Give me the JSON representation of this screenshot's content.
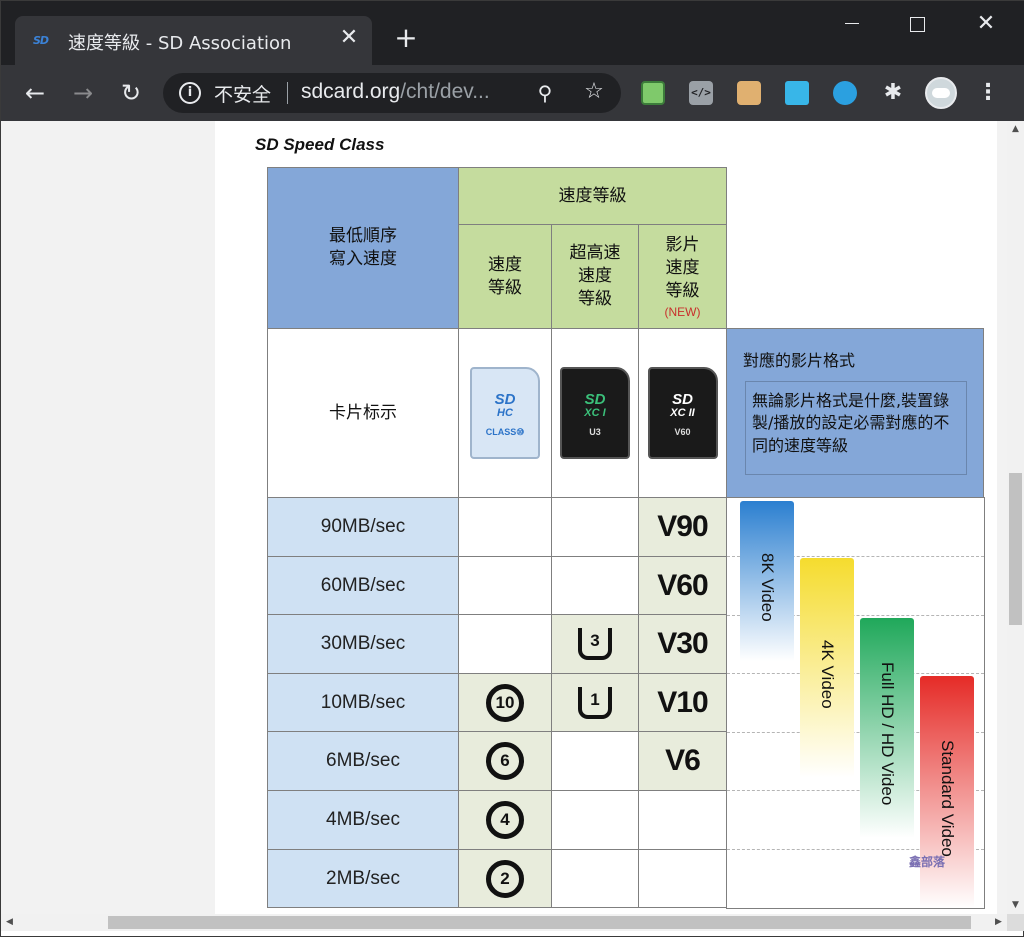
{
  "browser": {
    "tab_title": "速度等級 - SD Association",
    "tab_favicon": "SD",
    "security_label": "不安全",
    "url_host": "sdcard.org",
    "url_path": "/cht/dev...",
    "icons": {
      "back": "arrow-left-icon",
      "forward": "arrow-right-icon",
      "reload": "reload-icon",
      "info": "info-icon",
      "zoom": "zoom-icon",
      "bookmark": "star-icon",
      "extensions": "puzzle-icon",
      "menu": "kebab-menu-icon"
    }
  },
  "page": {
    "heading": "SD Speed Class",
    "table": {
      "col_min_write": "最低順序\n寫入速度",
      "col_speed_group": "速度等級",
      "col_speed_class": "速度\n等級",
      "col_uhs_class": "超高速\n速度\n等級",
      "col_video_class": "影片\n速度\n等級",
      "new_tag": "(NEW)",
      "card_label_row": "卡片标示",
      "cards": [
        {
          "logo": "SD",
          "type": "HC",
          "mark": "CLASS⑩"
        },
        {
          "logo": "SD",
          "type": "XC I",
          "mark": "U3"
        },
        {
          "logo": "SD",
          "type": "XC II",
          "mark": "V60"
        }
      ],
      "rows": [
        {
          "speed": "90MB/sec",
          "speed_class": "",
          "uhs": "",
          "video": "V90"
        },
        {
          "speed": "60MB/sec",
          "speed_class": "",
          "uhs": "",
          "video": "V60"
        },
        {
          "speed": "30MB/sec",
          "speed_class": "",
          "uhs": "3",
          "video": "V30"
        },
        {
          "speed": "10MB/sec",
          "speed_class": "10",
          "uhs": "1",
          "video": "V10"
        },
        {
          "speed": "6MB/sec",
          "speed_class": "6",
          "uhs": "",
          "video": "V6"
        },
        {
          "speed": "4MB/sec",
          "speed_class": "4",
          "uhs": "",
          "video": ""
        },
        {
          "speed": "2MB/sec",
          "speed_class": "2",
          "uhs": "",
          "video": ""
        }
      ]
    },
    "format_panel": {
      "title": "對應的影片格式",
      "note": "無論影片格式是什麼,裝置錄製/播放的設定必需對應的不同的速度等級"
    },
    "video_formats": [
      {
        "label": "8K Video",
        "color": "#2b7fd0"
      },
      {
        "label": "4K Video",
        "color": "#f5dc2e"
      },
      {
        "label": "Full HD / HD Video",
        "color": "#1fa85a"
      },
      {
        "label": "Standard Video",
        "color": "#e52b27"
      }
    ],
    "watermark": "鑫部落"
  },
  "colors": {
    "chrome_dark": "#202124",
    "chrome_toolbar": "#35363a",
    "header_blue": "#84a7d8",
    "header_green": "#c5dc9e",
    "row_blue": "#cfe1f3"
  }
}
